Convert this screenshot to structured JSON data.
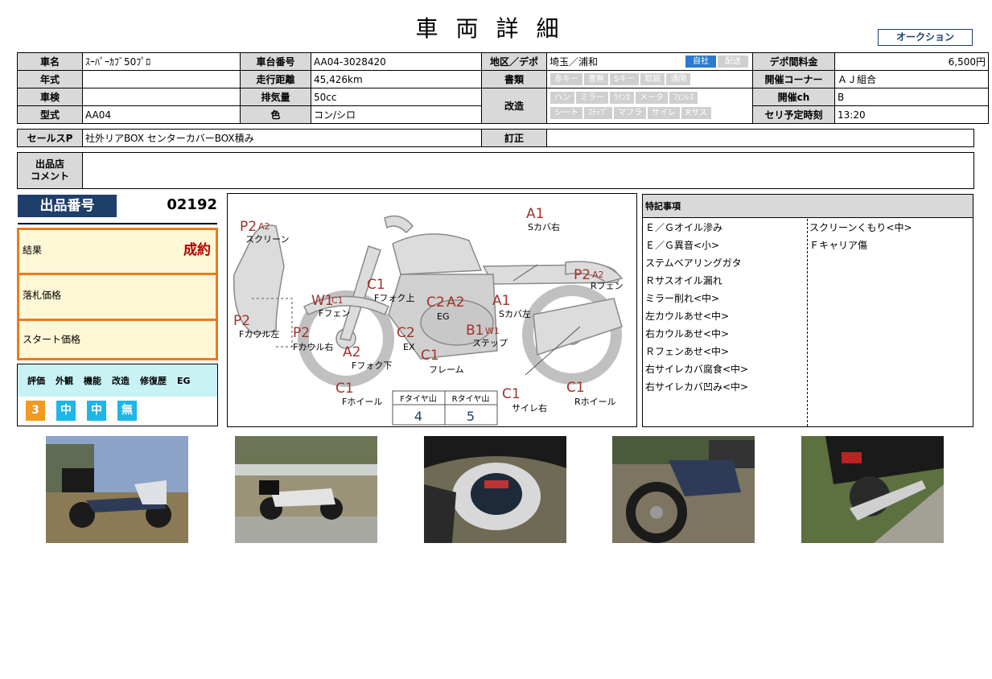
{
  "header": {
    "title": "車両詳細",
    "auction_label": "オークション"
  },
  "vehicle": {
    "name_label": "車名",
    "name": "ｽｰﾊﾟｰｶﾌﾞ50ﾌﾟﾛ",
    "frame_label": "車台番号",
    "frame": "AA04-3028420",
    "region_label": "地区／デポ",
    "region": "埼玉／浦和",
    "region_chip_self": "自社",
    "region_chip_delivery": "配送",
    "depot_fee_label": "デポ間料金",
    "depot_fee": "6,500円",
    "year_label": "年式",
    "year": "",
    "mileage_label": "走行距離",
    "mileage": "45,426km",
    "docs_label": "書類",
    "docs_chips": [
      "赤キー",
      "書無",
      "Sキー",
      "取説",
      "通関"
    ],
    "corner_label": "開催コーナー",
    "corner": "ＡＪ組合",
    "inspection_label": "車検",
    "inspection": "",
    "displacement_label": "排気量",
    "displacement": "50cc",
    "mods_label": "改造",
    "mods_chips_row1": [
      "ハン",
      "ミラー",
      "ｳｲﾝｶ",
      "メータ",
      "ﾌｪﾝﾚｽ"
    ],
    "mods_chips_row2": [
      "シート",
      "ｽﾃｯﾌﾟ",
      "マフラ",
      "サイレ",
      "Rサス"
    ],
    "channel_label": "開催ch",
    "channel": "B",
    "model_label": "型式",
    "model": "AA04",
    "color_label": "色",
    "color": "コン/シロ",
    "auction_time_label": "セリ予定時刻",
    "auction_time": "13:20",
    "sales_label": "セールスP",
    "sales": "社外リアBOX センターカバーBOX積み",
    "correction_label": "訂正",
    "correction": "",
    "comment_label_1": "出品店",
    "comment_label_2": "コメント",
    "comment": ""
  },
  "lot": {
    "label": "出品番号",
    "number": "02192"
  },
  "result": {
    "result_label": "結果",
    "result_value": "成約",
    "hammer_label": "落札価格",
    "hammer_value": "",
    "start_label": "スタート価格",
    "start_value": ""
  },
  "rating": {
    "headers": [
      "評価",
      "外観",
      "機能",
      "改造",
      "修復歴",
      "EG"
    ],
    "values": [
      "3",
      "中",
      "中",
      "無"
    ]
  },
  "diagram": {
    "labels": {
      "screen": "スクリーン",
      "s_cover_r": "Sカバ右",
      "f_fender": "Fフェン",
      "f_fork_up": "Fフォク上",
      "eg": "EG",
      "s_cover_l": "Sカバ左",
      "r_fender": "Rフェン",
      "f_cowl_l": "Fカウル左",
      "f_cowl_r": "Fカウル右",
      "ex": "EX",
      "step": "ステップ",
      "f_fork_down": "Fフォク下",
      "frame": "フレーム",
      "f_wheel": "Fホイール",
      "silencer_r": "サイレ右",
      "r_wheel": "Rホイール"
    },
    "codes": {
      "screen_1": "P2",
      "screen_2": "A2",
      "s_cover_r": "A1",
      "r_fender_1": "P2",
      "r_fender_2": "A2",
      "f_fender_1": "W1",
      "f_fender_2": "C1",
      "f_fork_up": "C1",
      "eg_1": "C2",
      "eg_2": "A2",
      "s_cover_l": "A1",
      "f_cowl_l": "P2",
      "f_cowl_r": "P2",
      "ex": "C2",
      "step_1": "B1",
      "step_2": "W1",
      "f_fork_down": "A2",
      "frame": "C1",
      "f_wheel": "C1",
      "silencer_r": "C1",
      "r_wheel": "C1"
    },
    "tire": {
      "front_label": "Fタイヤ山",
      "front_value": "4",
      "rear_label": "Rタイヤ山",
      "rear_value": "5"
    }
  },
  "notes": {
    "title": "特記事項",
    "col1": [
      "Ｅ／Ｇオイル滲み",
      "Ｅ／Ｇ異音<小>",
      "ステムベアリングガタ",
      "Ｒサスオイル漏れ",
      "ミラー削れ<中>",
      "左カウルあせ<中>",
      "右カウルあせ<中>",
      "Ｒフェンあせ<中>",
      "右サイレカバ腐食<中>",
      "右サイレカバ凹み<中>"
    ],
    "col2": [
      "スクリーンくもり<中>",
      "Ｆキャリア傷"
    ]
  },
  "colors": {
    "navy": "#1f3f6b",
    "orange": "#e87c1e",
    "result_red": "#b30000",
    "chip_on": "#2b7bd0",
    "chip_off": "#cfcfcf",
    "rating_head": "#c8f2f4",
    "rating_orange": "#f39a1e",
    "rating_cyan": "#1cb6e8",
    "code_red": "#a0332a"
  }
}
